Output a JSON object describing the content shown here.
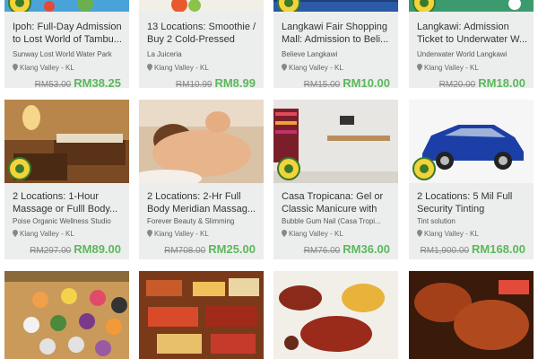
{
  "cards": [
    {
      "title": "Ipoh: Full-Day Admission to Lost World of Tambu...",
      "merchant": "Sunway Lost World Water Park",
      "location": "Klang Valley - KL",
      "old_price": "RM53.00",
      "new_price": "RM38.25"
    },
    {
      "title": "13 Locations: Smoothie / Buy 2 Cold-Pressed Juic...",
      "merchant": "La Juiceria",
      "location": "Klang Valley - KL",
      "old_price": "RM10.99",
      "new_price": "RM8.99"
    },
    {
      "title": "Langkawi Fair Shopping Mall: Admission to Beli...",
      "merchant": "Believe Langkawi",
      "location": "Klang Valley - KL",
      "old_price": "RM15.00",
      "new_price": "RM10.00"
    },
    {
      "title": "Langkawi: Admission Ticket to Underwater W...",
      "merchant": "Underwater World Langkawi",
      "location": "Klang Valley - KL",
      "old_price": "RM20.00",
      "new_price": "RM18.00"
    },
    {
      "title": "2 Locations: 1-Hour Massage or Fulll Body...",
      "merchant": "Poise Organic Wellness Studio",
      "location": "Klang Valley - KL",
      "old_price": "RM297.00",
      "new_price": "RM89.00"
    },
    {
      "title": "2 Locations: 2-Hr Full Body Meridian Massag...",
      "merchant": "Forever Beauty & Slimming",
      "location": "Klang Valley - KL",
      "old_price": "RM708.00",
      "new_price": "RM25.00"
    },
    {
      "title": "Casa Tropicana: Gel or Classic Manicure with C...",
      "merchant": "Bubble Gum Nail (Casa Tropi...",
      "location": "Klang Valley - KL",
      "old_price": "RM76.00",
      "new_price": "RM36.00"
    },
    {
      "title": "2 Locations: 5 Mil Full Security Tinting Packag...",
      "merchant": "Tint solution",
      "location": "Klang Valley - KL",
      "old_price": "RM1,900.00",
      "new_price": "RM168.00"
    },
    {
      "title": "",
      "merchant": "",
      "location": "",
      "old_price": "",
      "new_price": ""
    },
    {
      "title": "",
      "merchant": "",
      "location": "",
      "old_price": "",
      "new_price": ""
    },
    {
      "title": "",
      "merchant": "",
      "location": "",
      "old_price": "",
      "new_price": ""
    },
    {
      "title": "",
      "merchant": "",
      "location": "",
      "old_price": "",
      "new_price": ""
    }
  ],
  "colors": {
    "card_bg": "#eceeed",
    "price_green": "#5cb85c",
    "badge_yellow": "#f3d33a",
    "badge_green": "#3b7a2a"
  },
  "icons": {
    "location": "map-pin-icon",
    "badge": "deal-badge-icon"
  }
}
